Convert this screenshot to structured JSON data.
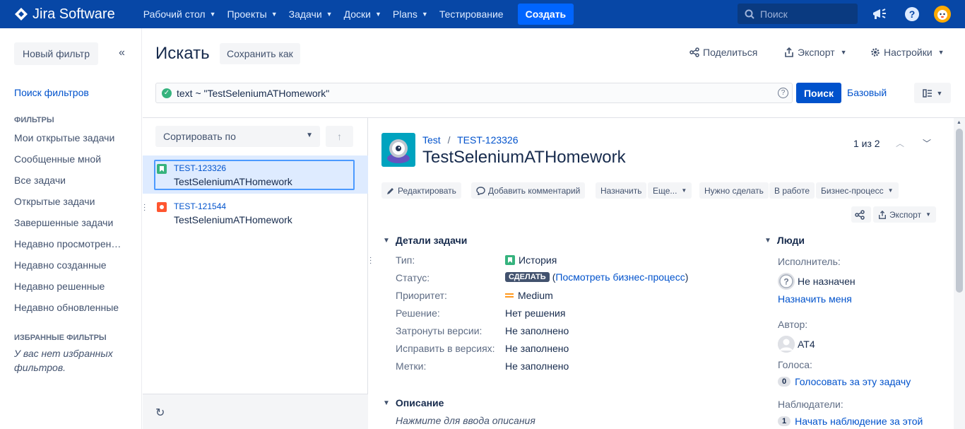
{
  "topnav": {
    "logo": "Jira Software",
    "items": [
      "Рабочий стол",
      "Проекты",
      "Задачи",
      "Доски",
      "Plans",
      "Тестирование"
    ],
    "create": "Создать",
    "search_placeholder": "Поиск"
  },
  "sidebar": {
    "new_filter": "Новый фильтр",
    "search_filters": "Поиск фильтров",
    "filters_heading": "ФИЛЬТРЫ",
    "filters": [
      "Мои открытые задачи",
      "Сообщенные мной",
      "Все задачи",
      "Открытые задачи",
      "Завершенные задачи",
      "Недавно просмотрен…",
      "Недавно созданные",
      "Недавно решенные",
      "Недавно обновленные"
    ],
    "fav_heading": "ИЗБРАННЫЕ ФИЛЬТРЫ",
    "fav_empty": "У вас нет избранных фильтров."
  },
  "header": {
    "title": "Искать",
    "save_as": "Сохранить как",
    "share": "Поделиться",
    "export": "Экспорт",
    "settings": "Настройки",
    "jql": "text ~ \"TestSeleniumATHomework\"",
    "search_btn": "Поиск",
    "basic": "Базовый"
  },
  "list": {
    "sort_by": "Сортировать по",
    "issues": [
      {
        "key": "TEST-123326",
        "summary": "TestSeleniumATHomework",
        "type": "story"
      },
      {
        "key": "TEST-121544",
        "summary": "TestSeleniumATHomework",
        "type": "bug"
      }
    ]
  },
  "issue": {
    "project": "Test",
    "key": "TEST-123326",
    "title": "TestSeleniumATHomework",
    "pager": "1 из 2",
    "toolbar": {
      "edit": "Редактировать",
      "comment": "Добавить комментарий",
      "assign": "Назначить",
      "more": "Еще...",
      "todo": "Нужно сделать",
      "inprogress": "В работе",
      "workflow": "Бизнес-процесс",
      "export": "Экспорт"
    },
    "details": {
      "heading": "Детали задачи",
      "type_label": "Тип:",
      "type_value": "История",
      "status_label": "Статус:",
      "status_value": "СДЕЛАТЬ",
      "status_link_open": "(",
      "status_link": "Посмотреть бизнес-процесс",
      "status_link_close": ")",
      "priority_label": "Приоритет:",
      "priority_value": "Medium",
      "resolution_label": "Решение:",
      "resolution_value": "Нет решения",
      "affects_label": "Затронуты версии:",
      "affects_value": "Не заполнено",
      "fix_label": "Исправить в версиях:",
      "fix_value": "Не заполнено",
      "labels_label": "Метки:",
      "labels_value": "Не заполнено"
    },
    "description": {
      "heading": "Описание",
      "placeholder": "Нажмите для ввода описания"
    },
    "people": {
      "heading": "Люди",
      "assignee_label": "Исполнитель:",
      "assignee_value": "Не назначен",
      "assign_me": "Назначить меня",
      "reporter_label": "Автор:",
      "reporter_value": "AT4",
      "votes_label": "Голоса:",
      "votes_count": "0",
      "vote_link": "Голосовать за эту задачу",
      "watchers_label": "Наблюдатели:",
      "watchers_count": "1",
      "watch_link": "Начать наблюдение за этой"
    }
  },
  "colors": {
    "nav_bg": "#0747a6",
    "primary": "#0052cc",
    "story": "#36b37e",
    "bug": "#ff5630"
  }
}
